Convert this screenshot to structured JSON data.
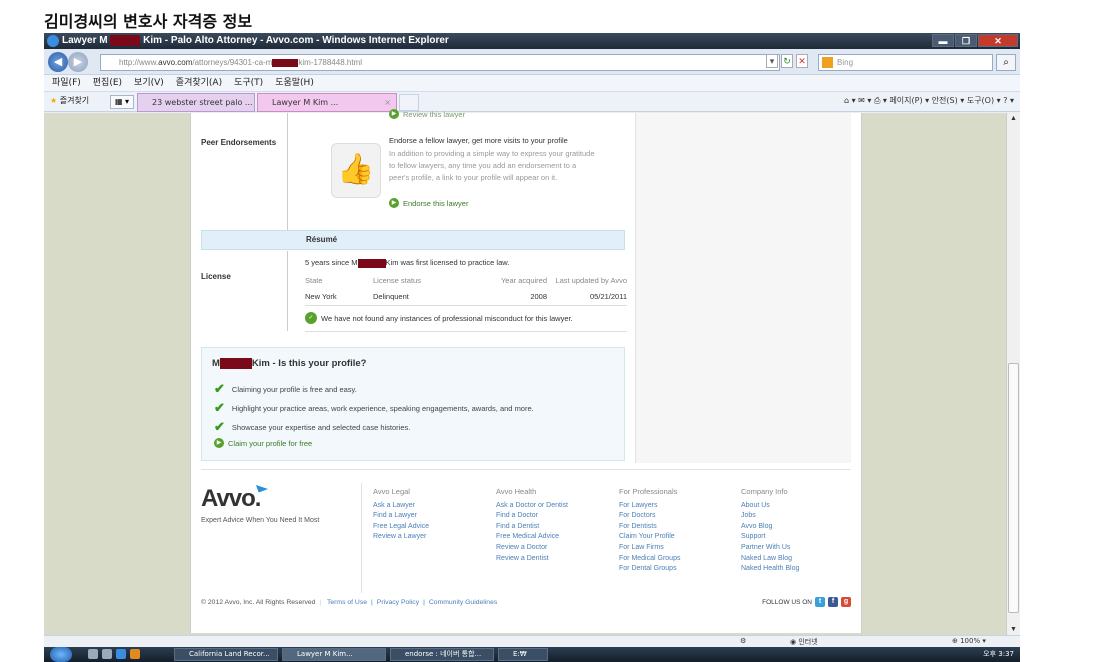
{
  "caption": "김미경씨의 변호사 자격증 정보",
  "window": {
    "title_prefix": "Lawyer M",
    "title_suffix": "Kim - Palo Alto Attorney - Avvo.com - Windows Internet Explorer",
    "min_label": "▬",
    "max_label": "❐",
    "close_label": "✕"
  },
  "address": {
    "prefix": "http://www.",
    "domain": "avvo.com",
    "path": "/attorneys/94301-ca-m",
    "suffix": "kim-1788448.html"
  },
  "search": {
    "placeholder": "Bing"
  },
  "menu": [
    "파일(F)",
    "편집(E)",
    "보기(V)",
    "즐겨찾기(A)",
    "도구(T)",
    "도움말(H)"
  ],
  "favorites": {
    "label": "즐겨찾기",
    "tab1": "23 webster street palo ...",
    "tab2": "Lawyer M       Kim ...",
    "tab_close": "×"
  },
  "command_bar": "⌂ ▾  ✉ ▾  ⎙ ▾  페이지(P) ▾  안전(S) ▾  도구(O) ▾  ? ▾",
  "profile": {
    "review_link": "Review this lawyer",
    "peer_label": "Peer Endorsements",
    "endorse_heading": "Endorse a fellow lawyer, get more visits to your profile",
    "endorse_body": [
      "In addition to providing a simple way to express your gratitude",
      "to fellow lawyers, any time you add an endorsement to a",
      "peer's profile, a link to your profile will appear on it."
    ],
    "endorse_link": "Endorse this lawyer",
    "resume_label": "Résumé",
    "license_label": "License",
    "licensed_pre": "5 years since M",
    "licensed_post": "Kim was first licensed to practice law.",
    "license_headers": [
      "State",
      "License status",
      "Year acquired",
      "Last updated by Avvo"
    ],
    "license_row": [
      "New York",
      "Delinquent",
      "2008",
      "05/21/2011"
    ],
    "misconduct": "We have not found any instances of professional misconduct for this lawyer."
  },
  "claim": {
    "title_pre": "M",
    "title_post": "Kim - Is this your profile?",
    "items": [
      "Claiming your profile is free and easy.",
      "Highlight your practice areas, work experience, speaking engagements, awards, and more.",
      "Showcase your expertise and selected case histories."
    ],
    "link": "Claim your profile for free"
  },
  "footer": {
    "logo": "Avvo.",
    "tagline": "Expert Advice When You Need It Most",
    "columns": [
      {
        "heading": "Avvo Legal",
        "links": [
          "Ask a Lawyer",
          "Find a Lawyer",
          "Free Legal Advice",
          "Review a Lawyer"
        ]
      },
      {
        "heading": "Avvo Health",
        "links": [
          "Ask a Doctor or Dentist",
          "Find a Doctor",
          "Find a Dentist",
          "Free Medical Advice",
          "Review a Doctor",
          "Review a Dentist"
        ]
      },
      {
        "heading": "For Professionals",
        "links": [
          "For Lawyers",
          "For Doctors",
          "For Dentists",
          "Claim Your Profile",
          "For Law Firms",
          "For Medical Groups",
          "For Dental Groups"
        ]
      },
      {
        "heading": "Company Info",
        "links": [
          "About Us",
          "Jobs",
          "Avvo Blog",
          "Support",
          "Partner With Us",
          "Naked Law Blog",
          "Naked Health Blog"
        ]
      }
    ],
    "copyright": "© 2012 Avvo, Inc. All Rights Reserved",
    "terms": "Terms of Use",
    "privacy": "Privacy Policy",
    "community": "Community Guidelines",
    "follow": "FOLLOW US ON"
  },
  "status": {
    "zone": "인터넷",
    "zoom": "100%"
  },
  "taskbar": {
    "items": [
      "California Land Recor...",
      "Lawyer M       Kim...",
      "endorse : 네이버 통합...",
      "E:₩"
    ],
    "clock": "오후 3:37"
  },
  "colors": {
    "accent_green": "#5aa02c",
    "link_blue": "#4a7fb8",
    "redaction": "#7a0a1a"
  }
}
